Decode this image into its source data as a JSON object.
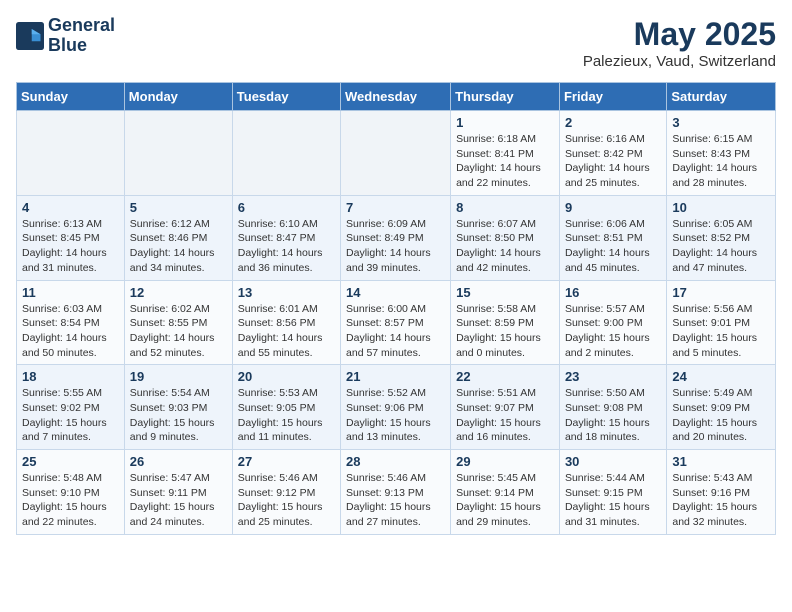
{
  "logo": {
    "line1": "General",
    "line2": "Blue"
  },
  "title": "May 2025",
  "location": "Palezieux, Vaud, Switzerland",
  "weekdays": [
    "Sunday",
    "Monday",
    "Tuesday",
    "Wednesday",
    "Thursday",
    "Friday",
    "Saturday"
  ],
  "weeks": [
    [
      {
        "day": "",
        "info": ""
      },
      {
        "day": "",
        "info": ""
      },
      {
        "day": "",
        "info": ""
      },
      {
        "day": "",
        "info": ""
      },
      {
        "day": "1",
        "info": "Sunrise: 6:18 AM\nSunset: 8:41 PM\nDaylight: 14 hours\nand 22 minutes."
      },
      {
        "day": "2",
        "info": "Sunrise: 6:16 AM\nSunset: 8:42 PM\nDaylight: 14 hours\nand 25 minutes."
      },
      {
        "day": "3",
        "info": "Sunrise: 6:15 AM\nSunset: 8:43 PM\nDaylight: 14 hours\nand 28 minutes."
      }
    ],
    [
      {
        "day": "4",
        "info": "Sunrise: 6:13 AM\nSunset: 8:45 PM\nDaylight: 14 hours\nand 31 minutes."
      },
      {
        "day": "5",
        "info": "Sunrise: 6:12 AM\nSunset: 8:46 PM\nDaylight: 14 hours\nand 34 minutes."
      },
      {
        "day": "6",
        "info": "Sunrise: 6:10 AM\nSunset: 8:47 PM\nDaylight: 14 hours\nand 36 minutes."
      },
      {
        "day": "7",
        "info": "Sunrise: 6:09 AM\nSunset: 8:49 PM\nDaylight: 14 hours\nand 39 minutes."
      },
      {
        "day": "8",
        "info": "Sunrise: 6:07 AM\nSunset: 8:50 PM\nDaylight: 14 hours\nand 42 minutes."
      },
      {
        "day": "9",
        "info": "Sunrise: 6:06 AM\nSunset: 8:51 PM\nDaylight: 14 hours\nand 45 minutes."
      },
      {
        "day": "10",
        "info": "Sunrise: 6:05 AM\nSunset: 8:52 PM\nDaylight: 14 hours\nand 47 minutes."
      }
    ],
    [
      {
        "day": "11",
        "info": "Sunrise: 6:03 AM\nSunset: 8:54 PM\nDaylight: 14 hours\nand 50 minutes."
      },
      {
        "day": "12",
        "info": "Sunrise: 6:02 AM\nSunset: 8:55 PM\nDaylight: 14 hours\nand 52 minutes."
      },
      {
        "day": "13",
        "info": "Sunrise: 6:01 AM\nSunset: 8:56 PM\nDaylight: 14 hours\nand 55 minutes."
      },
      {
        "day": "14",
        "info": "Sunrise: 6:00 AM\nSunset: 8:57 PM\nDaylight: 14 hours\nand 57 minutes."
      },
      {
        "day": "15",
        "info": "Sunrise: 5:58 AM\nSunset: 8:59 PM\nDaylight: 15 hours\nand 0 minutes."
      },
      {
        "day": "16",
        "info": "Sunrise: 5:57 AM\nSunset: 9:00 PM\nDaylight: 15 hours\nand 2 minutes."
      },
      {
        "day": "17",
        "info": "Sunrise: 5:56 AM\nSunset: 9:01 PM\nDaylight: 15 hours\nand 5 minutes."
      }
    ],
    [
      {
        "day": "18",
        "info": "Sunrise: 5:55 AM\nSunset: 9:02 PM\nDaylight: 15 hours\nand 7 minutes."
      },
      {
        "day": "19",
        "info": "Sunrise: 5:54 AM\nSunset: 9:03 PM\nDaylight: 15 hours\nand 9 minutes."
      },
      {
        "day": "20",
        "info": "Sunrise: 5:53 AM\nSunset: 9:05 PM\nDaylight: 15 hours\nand 11 minutes."
      },
      {
        "day": "21",
        "info": "Sunrise: 5:52 AM\nSunset: 9:06 PM\nDaylight: 15 hours\nand 13 minutes."
      },
      {
        "day": "22",
        "info": "Sunrise: 5:51 AM\nSunset: 9:07 PM\nDaylight: 15 hours\nand 16 minutes."
      },
      {
        "day": "23",
        "info": "Sunrise: 5:50 AM\nSunset: 9:08 PM\nDaylight: 15 hours\nand 18 minutes."
      },
      {
        "day": "24",
        "info": "Sunrise: 5:49 AM\nSunset: 9:09 PM\nDaylight: 15 hours\nand 20 minutes."
      }
    ],
    [
      {
        "day": "25",
        "info": "Sunrise: 5:48 AM\nSunset: 9:10 PM\nDaylight: 15 hours\nand 22 minutes."
      },
      {
        "day": "26",
        "info": "Sunrise: 5:47 AM\nSunset: 9:11 PM\nDaylight: 15 hours\nand 24 minutes."
      },
      {
        "day": "27",
        "info": "Sunrise: 5:46 AM\nSunset: 9:12 PM\nDaylight: 15 hours\nand 25 minutes."
      },
      {
        "day": "28",
        "info": "Sunrise: 5:46 AM\nSunset: 9:13 PM\nDaylight: 15 hours\nand 27 minutes."
      },
      {
        "day": "29",
        "info": "Sunrise: 5:45 AM\nSunset: 9:14 PM\nDaylight: 15 hours\nand 29 minutes."
      },
      {
        "day": "30",
        "info": "Sunrise: 5:44 AM\nSunset: 9:15 PM\nDaylight: 15 hours\nand 31 minutes."
      },
      {
        "day": "31",
        "info": "Sunrise: 5:43 AM\nSunset: 9:16 PM\nDaylight: 15 hours\nand 32 minutes."
      }
    ]
  ]
}
